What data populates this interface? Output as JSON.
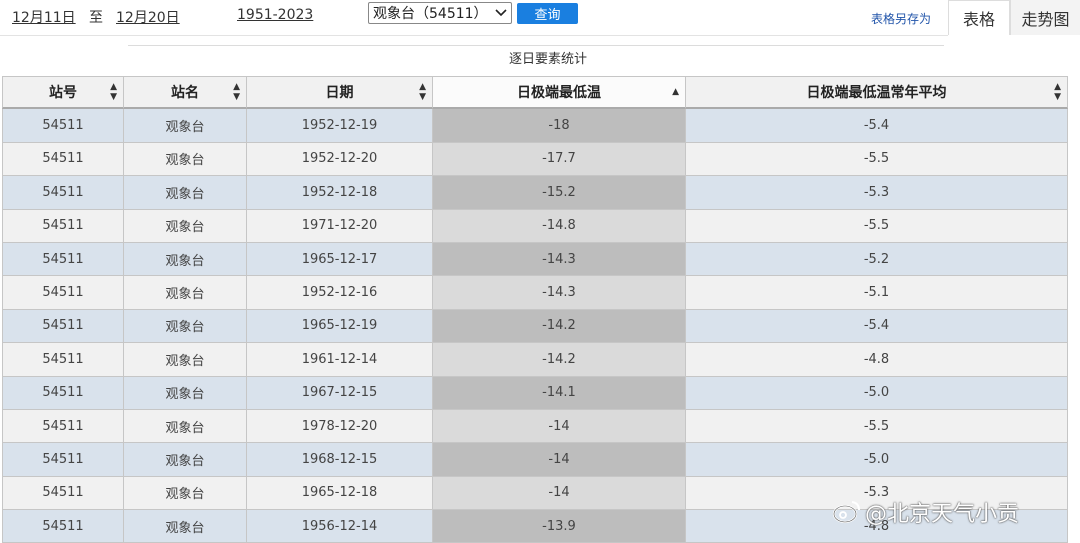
{
  "toolbar": {
    "start_date": "12月11日",
    "to_label": "至",
    "end_date": "12月20日",
    "year_range": "1951-2023",
    "station_selected": "观象台（54511）",
    "query_label": "查询",
    "save_label": "表格另存为"
  },
  "tabs": [
    {
      "label": "表格",
      "active": true
    },
    {
      "label": "走势图",
      "active": false
    }
  ],
  "subtitle": "逐日要素统计",
  "columns": [
    "站号",
    "站名",
    "日期",
    "日极端最低温",
    "日极端最低温常年平均"
  ],
  "sort": {
    "column": "日极端最低温",
    "direction": "ascending"
  },
  "rows": [
    [
      "54511",
      "观象台",
      "1952-12-19",
      "-18",
      "-5.4"
    ],
    [
      "54511",
      "观象台",
      "1952-12-20",
      "-17.7",
      "-5.5"
    ],
    [
      "54511",
      "观象台",
      "1952-12-18",
      "-15.2",
      "-5.3"
    ],
    [
      "54511",
      "观象台",
      "1971-12-20",
      "-14.8",
      "-5.5"
    ],
    [
      "54511",
      "观象台",
      "1965-12-17",
      "-14.3",
      "-5.2"
    ],
    [
      "54511",
      "观象台",
      "1952-12-16",
      "-14.3",
      "-5.1"
    ],
    [
      "54511",
      "观象台",
      "1965-12-19",
      "-14.2",
      "-5.4"
    ],
    [
      "54511",
      "观象台",
      "1961-12-14",
      "-14.2",
      "-4.8"
    ],
    [
      "54511",
      "观象台",
      "1967-12-15",
      "-14.1",
      "-5.0"
    ],
    [
      "54511",
      "观象台",
      "1978-12-20",
      "-14",
      "-5.5"
    ],
    [
      "54511",
      "观象台",
      "1968-12-15",
      "-14",
      "-5.0"
    ],
    [
      "54511",
      "观象台",
      "1965-12-18",
      "-14",
      "-5.3"
    ],
    [
      "54511",
      "观象台",
      "1956-12-14",
      "-13.9",
      "-4.8"
    ]
  ],
  "watermark": "@北京天气小贡",
  "colors": {
    "query_button": "#1a7fe0",
    "row_odd": "#d9e2ec",
    "row_even": "#f1f1f1",
    "sorted_col_odd": "#bdbdbd",
    "sorted_col_even": "#dadada"
  }
}
